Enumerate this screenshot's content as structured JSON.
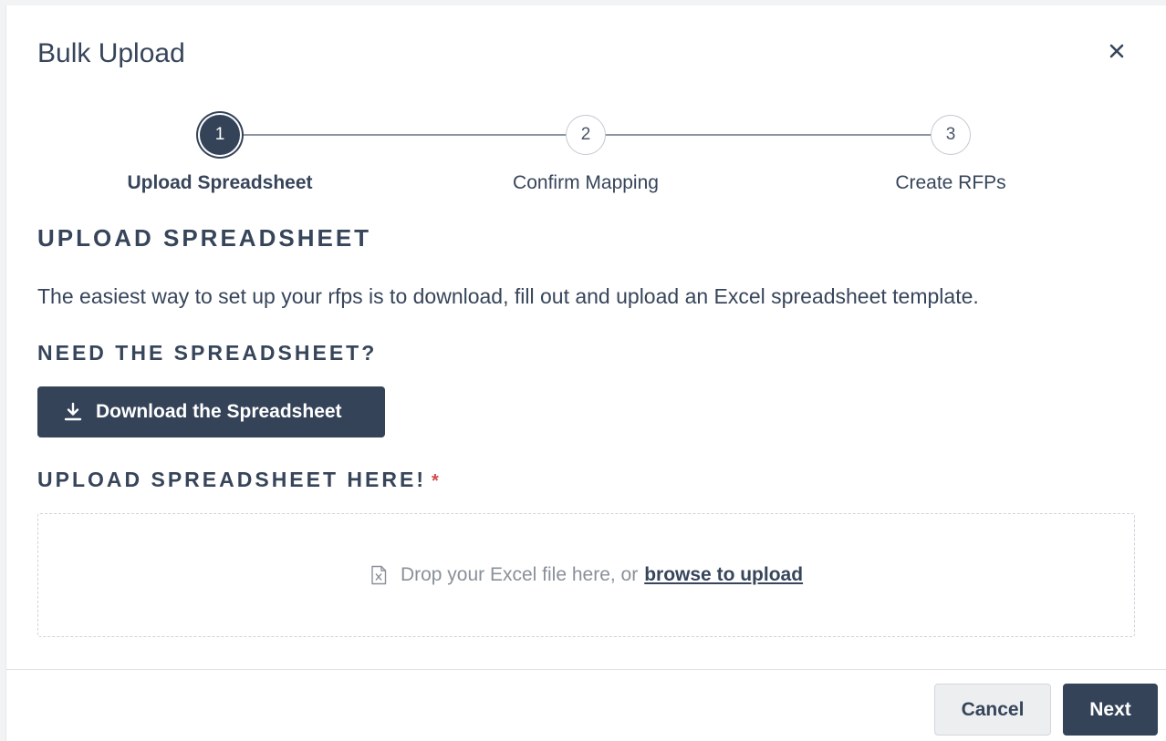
{
  "dialog": {
    "title": "Bulk Upload",
    "close_icon": "close-icon"
  },
  "stepper": {
    "steps": [
      {
        "number": "1",
        "label": "Upload Spreadsheet",
        "state": "active"
      },
      {
        "number": "2",
        "label": "Confirm Mapping",
        "state": "inactive"
      },
      {
        "number": "3",
        "label": "Create RFPs",
        "state": "inactive"
      }
    ]
  },
  "content": {
    "section_title": "UPLOAD SPREADSHEET",
    "description": "The easiest way to set up your rfps is to download, fill out and upload an Excel spreadsheet template.",
    "need_title": "NEED THE SPREADSHEET?",
    "download_button": "Download the Spreadsheet",
    "download_icon": "download-icon",
    "upload_title": "UPLOAD SPREADSHEET HERE!",
    "required_mark": "*",
    "dropzone": {
      "icon": "excel-file-icon",
      "text": "Drop your Excel file here, or",
      "link": "browse to upload"
    }
  },
  "footer": {
    "cancel": "Cancel",
    "next": "Next"
  },
  "colors": {
    "primary": "#344358",
    "text": "#37455a",
    "required": "#d34a4a"
  }
}
